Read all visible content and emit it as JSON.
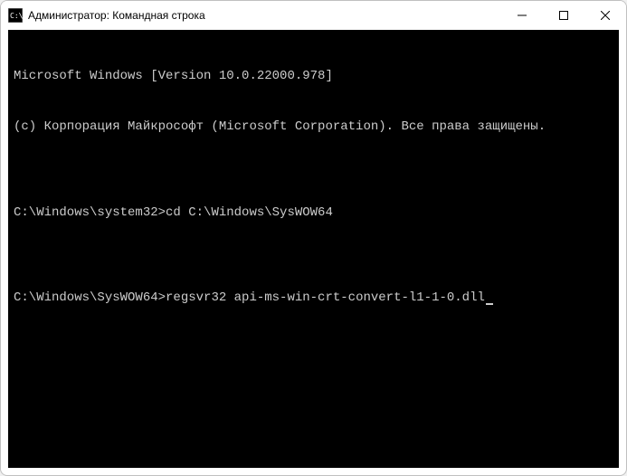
{
  "window": {
    "title": "Администратор: Командная строка"
  },
  "terminal": {
    "line1": "Microsoft Windows [Version 10.0.22000.978]",
    "line2": "(c) Корпорация Майкрософт (Microsoft Corporation). Все права защищены.",
    "blank1": "",
    "prompt1_path": "C:\\Windows\\system32>",
    "prompt1_cmd": "cd C:\\Windows\\SysWOW64",
    "blank2": "",
    "prompt2_path": "C:\\Windows\\SysWOW64>",
    "prompt2_cmd": "regsvr32 api-ms-win-crt-convert-l1-1-0.dll"
  }
}
